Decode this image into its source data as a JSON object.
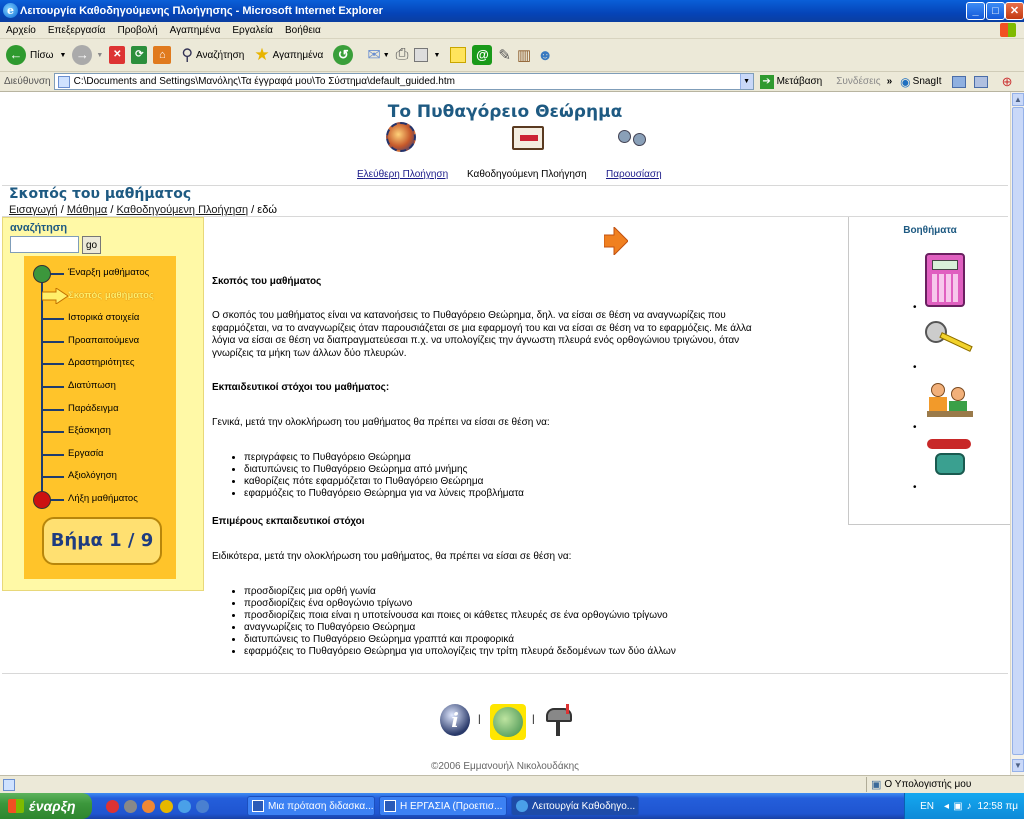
{
  "window": {
    "title": "Λειτουργία Καθοδηγούμενης Πλοήγησης - Microsoft Internet Explorer",
    "ie_logo_glyph": "e"
  },
  "menu": [
    "Αρχείο",
    "Επεξεργασία",
    "Προβολή",
    "Αγαπημένα",
    "Εργαλεία",
    "Βοήθεια"
  ],
  "toolbar": {
    "back": "Πίσω",
    "search": "Αναζήτηση",
    "favorites": "Αγαπημένα"
  },
  "address": {
    "label": "Διεύθυνση",
    "value": "C:\\Documents and Settings\\Μανόλης\\Τα έγγραφά μου\\Το Σύστημα\\default_guided.htm",
    "go": "Μετάβαση",
    "links": "Συνδέσεις",
    "snagit": "SnagIt"
  },
  "header": {
    "title": "Το Πυθαγόρειο Θεώρημα",
    "nav": [
      {
        "label": "Ελεύθερη Πλοήγηση",
        "link": true
      },
      {
        "label": "Καθοδηγούμενη Πλοήγηση",
        "link": false
      },
      {
        "label": "Παρουσίαση",
        "link": true
      }
    ]
  },
  "section": {
    "title": "Σκοπός του μαθήματος",
    "breadcrumb": {
      "items": [
        "Εισαγωγή",
        "Μάθημα",
        "Καθοδηγούμενη Πλοήγηση"
      ],
      "sep": "/",
      "current": "εδώ"
    }
  },
  "sidebar": {
    "search_label": "αναζήτηση",
    "search_value": "",
    "go": "go",
    "steps": [
      "Έναρξη μαθήματος",
      "Σκοπός μαθήματος",
      "Ιστορικά στοιχεία",
      "Προαπαιτούμενα",
      "Δραστηριότητες",
      "Διατύπωση",
      "Παράδειγμα",
      "Εξάσκηση",
      "Εργασία",
      "Αξιολόγηση",
      "Λήξη μαθήματος"
    ],
    "current_step": 1,
    "step_counter": "Βήμα 1 / 9"
  },
  "main": {
    "heading1": "Σκοπός του μαθήματος",
    "para1": "Ο σκοπός του μαθήματος είναι να κατανοήσεις το Πυθαγόρειο Θεώρημα, δηλ. να είσαι σε θέση να αναγνωρίζεις που εφαρμόζεται, να το αναγνωρίζεις όταν παρουσιάζεται σε μια εφαρμογή του και να είσαι σε θέση να το εφαρμόζεις. Με άλλα λόγια να είσαι σε θέση να διαπραγματεύεσαι π.χ. να υπολογίζεις την άγνωστη πλευρά ενός ορθογώνιου τριγώνου, όταν γνωρίζεις τα μήκη των άλλων δύο πλευρών.",
    "heading2": "Εκπαιδευτικοί στόχοι του μαθήματος:",
    "para2": "Γενικά, μετά την ολοκλήρωση του μαθήματος θα πρέπει να είσαι σε θέση να:",
    "list1": [
      "περιγράφεις το Πυθαγόρειο Θεώρημα",
      "διατυπώνεις το Πυθαγόρειο Θεώρημα από μνήμης",
      "καθορίζεις πότε εφαρμόζεται το Πυθαγόρειο Θεώρημα",
      "εφαρμόζεις το Πυθαγόρειο Θεώρημα για να λύνεις προβλήματα"
    ],
    "heading3": "Επιμέρους εκπαιδευτικοί στόχοι",
    "para3": "Ειδικότερα, μετά την ολοκλήρωση του μαθήματος, θα πρέπει να είσαι σε θέση να:",
    "list2": [
      "προσδιορίζεις μια ορθή γωνία",
      "προσδιορίζεις ένα ορθογώνιο τρίγωνο",
      "προσδιορίζεις ποια είναι η υποτείνουσα και ποιες οι κάθετες πλευρές σε ένα ορθογώνιο τρίγωνο",
      "αναγνωρίζεις το Πυθαγόρειο Θεώρημα",
      "διατυπώνεις το Πυθαγόρειο Θεώρημα γραπτά και προφορικά",
      "εφαρμόζεις το Πυθαγόρειο Θεώρημα για υπολογίζεις την τρίτη πλευρά δεδομένων των δύο άλλων"
    ]
  },
  "aids": {
    "title": "Βοηθήματα",
    "items": [
      "calculator-icon",
      "tape-measure-icon",
      "students-icon",
      "telephone-icon"
    ]
  },
  "footer": {
    "copyright": "©2006 Εμμανουήλ Νικολουδάκης",
    "sep": "|"
  },
  "status": {
    "zone": "Ο Υπολογιστής μου"
  },
  "taskbar": {
    "start": "έναρξη",
    "tasks": [
      "Μια πρόταση διδασκα...",
      "Η ΕΡΓΑΣΙΑ (Προεπισ...",
      "Λειτουργία Καθοδηγο..."
    ],
    "lang": "EN",
    "clock": "12:58 πμ"
  },
  "colors": {
    "title_blue": "#1e5a82",
    "sidebar_bg": "#fff9a6",
    "nav_orange": "#ffc42a",
    "start_green": "#3c973c",
    "end_red": "#cc1111"
  }
}
